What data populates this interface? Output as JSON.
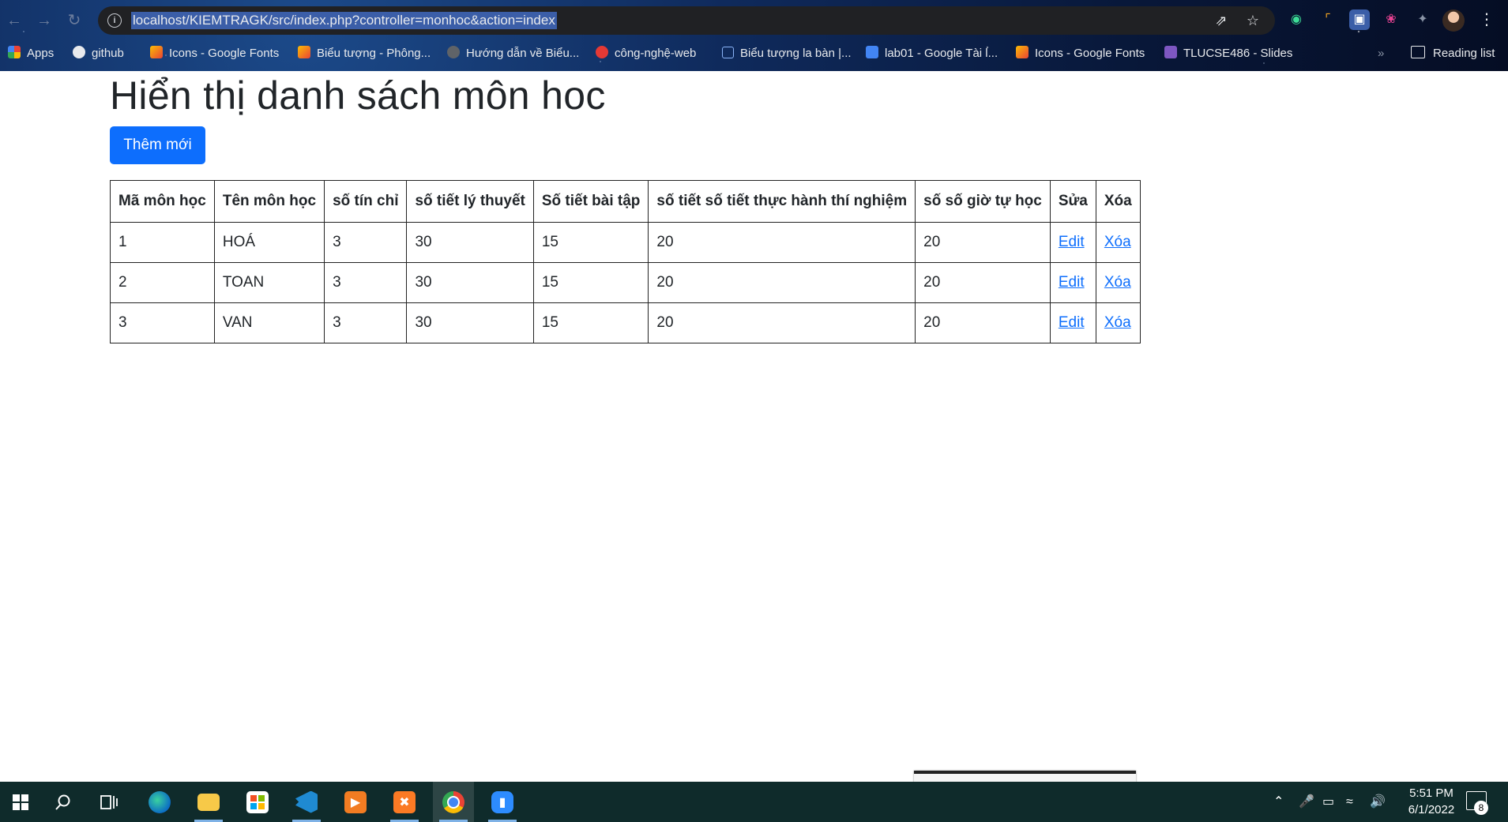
{
  "browser": {
    "url": "localhost/KIEMTRAGK/src/index.php?controller=monhoc&action=index",
    "bookmarks": [
      {
        "label": "Apps",
        "icon": "apps-grid-icon",
        "color": "#f4b400"
      },
      {
        "label": "github",
        "icon": "github-icon",
        "color": "#111111"
      },
      {
        "label": "Icons - Google Fonts",
        "icon": "google-fonts-icon",
        "color": "#fbbc04"
      },
      {
        "label": "Biểu tượng - Phông...",
        "icon": "google-fonts-icon",
        "color": "#fbbc04"
      },
      {
        "label": "Hướng dẫn về Biểu...",
        "icon": "globe-icon",
        "color": "#5f6368"
      },
      {
        "label": "công-nghệ-web",
        "icon": "web-app-icon",
        "color": "#e53935"
      },
      {
        "label": "Biểu tượng la bàn |...",
        "icon": "compass-page-icon",
        "color": "#8ab4f8"
      },
      {
        "label": "lab01 - Google Tài l...",
        "icon": "google-docs-icon",
        "color": "#4285f4"
      },
      {
        "label": "Icons - Google Fonts",
        "icon": "google-fonts-icon",
        "color": "#fbbc04"
      },
      {
        "label": "TLUCSE486 - Slides",
        "icon": "classroom-icon",
        "color": "#7e57c2"
      }
    ],
    "reading_list": "Reading list"
  },
  "page": {
    "title": "Hiển thị danh sách môn hoc",
    "add_button": "Thêm mới",
    "table": {
      "headers": [
        "Mã môn học",
        "Tên môn học",
        "số tín chỉ",
        "số tiết lý thuyết",
        "Số tiết bài tập",
        "số tiết số tiết thực hành thí nghiệm",
        "số số giờ tự học",
        "Sửa",
        "Xóa"
      ],
      "rows": [
        {
          "id": "1",
          "name": "HOÁ",
          "credits": "3",
          "theory": "30",
          "exercise": "15",
          "lab": "20",
          "self_study": "20",
          "edit": "Edit",
          "delete": "Xóa"
        },
        {
          "id": "2",
          "name": "TOAN",
          "credits": "3",
          "theory": "30",
          "exercise": "15",
          "lab": "20",
          "self_study": "20",
          "edit": "Edit",
          "delete": "Xóa"
        },
        {
          "id": "3",
          "name": "VAN",
          "credits": "3",
          "theory": "30",
          "exercise": "15",
          "lab": "20",
          "self_study": "20",
          "edit": "Edit",
          "delete": "Xóa"
        }
      ]
    }
  },
  "taskbar": {
    "time": "5:51 PM",
    "date": "6/1/2022",
    "notification_count": "8",
    "apps": [
      "start-icon",
      "search-icon",
      "task-view-icon",
      "edge-icon",
      "file-explorer-icon",
      "store-icon",
      "vscode-icon",
      "media-player-icon",
      "xampp-icon",
      "chrome-icon",
      "zoom-icon"
    ]
  },
  "colors": {
    "primary": "#0d6efd",
    "link": "#0d6efd",
    "taskbar": "#0f2b2b",
    "omnibox": "#202124"
  }
}
